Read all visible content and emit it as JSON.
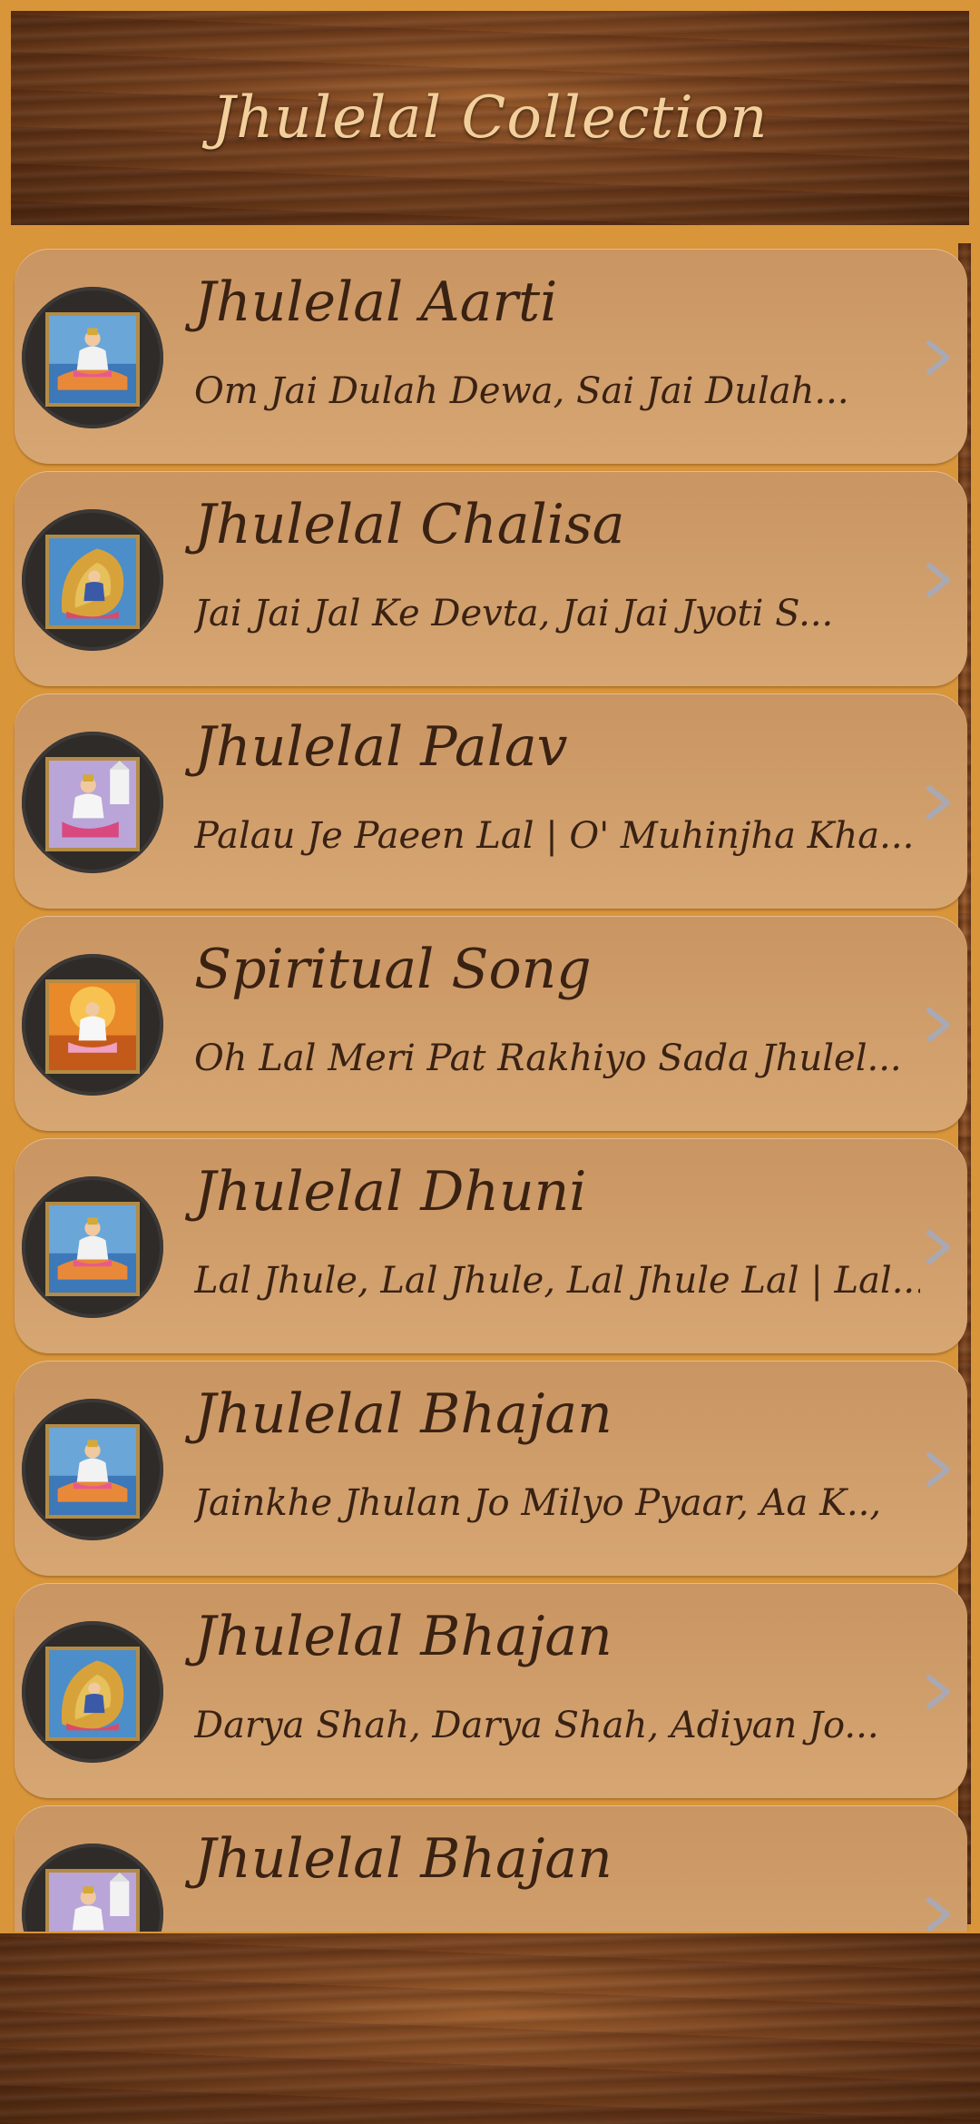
{
  "app": {
    "title": "Jhulelal Collection"
  },
  "colors": {
    "accent": "#d9953a",
    "card": "#cf9d6a",
    "text": "#3a2213",
    "title_text": "#f2cf9b"
  },
  "items": [
    {
      "title": "Jhulelal Aarti",
      "subtitle": "Om Jai Dulah Dewa, Sai Jai Dulah...",
      "thumb": "jhulelal-seated-blue"
    },
    {
      "title": "Jhulelal Chalisa",
      "subtitle": "Jai Jai Jal Ke Devta, Jai Jai Jyoti S...",
      "thumb": "jhulelal-fish-gold"
    },
    {
      "title": "Jhulelal Palav",
      "subtitle": "Palau Je Paeen Lal | O' Muhinjha Kha...",
      "thumb": "jhulelal-temple-purple"
    },
    {
      "title": "Spiritual Song",
      "subtitle": "Oh Lal Meri Pat Rakhiyo Sada Jhulel...",
      "thumb": "jhulelal-sunset-orange"
    },
    {
      "title": "Jhulelal Dhuni",
      "subtitle": "Lal Jhule, Lal Jhule, Lal Jhule Lal | Lal...",
      "thumb": "jhulelal-seated-blue"
    },
    {
      "title": "Jhulelal Bhajan",
      "subtitle": "Jainkhe Jhulan Jo Milyo Pyaar, Aa K..,",
      "thumb": "jhulelal-seated-blue"
    },
    {
      "title": "Jhulelal Bhajan",
      "subtitle": "Darya Shah, Darya Shah, Adiyan Jo...",
      "thumb": "jhulelal-fish-gold"
    },
    {
      "title": "Jhulelal Bhajan",
      "subtitle": "",
      "thumb": "jhulelal-temple-purple"
    }
  ]
}
